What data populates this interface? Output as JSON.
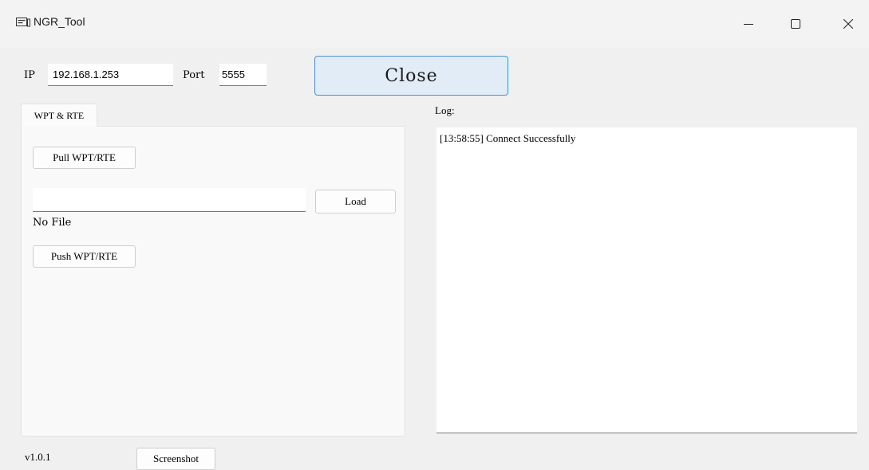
{
  "window": {
    "title": "NGR_Tool",
    "icon": "app-window-icon",
    "controls": [
      "minimize-icon",
      "maximize-icon",
      "close-icon"
    ]
  },
  "connection": {
    "ip_label": "IP",
    "ip_value": "192.168.1.253",
    "port_label": "Port",
    "port_value": "5555",
    "close_label": "Close"
  },
  "tabs": [
    {
      "label": "WPT & RTE",
      "selected": true
    }
  ],
  "wpt_panel": {
    "pull_label": "Pull WPT/RTE",
    "file_value": "",
    "load_label": "Load",
    "file_status": "No File",
    "push_label": "Push WPT/RTE"
  },
  "log": {
    "label": "Log:",
    "entries": [
      "[13:58:55] Connect Successfully"
    ]
  },
  "footer": {
    "version": "v1.0.1",
    "screenshot_label": "Screenshot"
  },
  "colors": {
    "accent_border": "#4a92d6",
    "accent_fill": "#e1ecf6",
    "window_bg": "#f0f0f0"
  }
}
